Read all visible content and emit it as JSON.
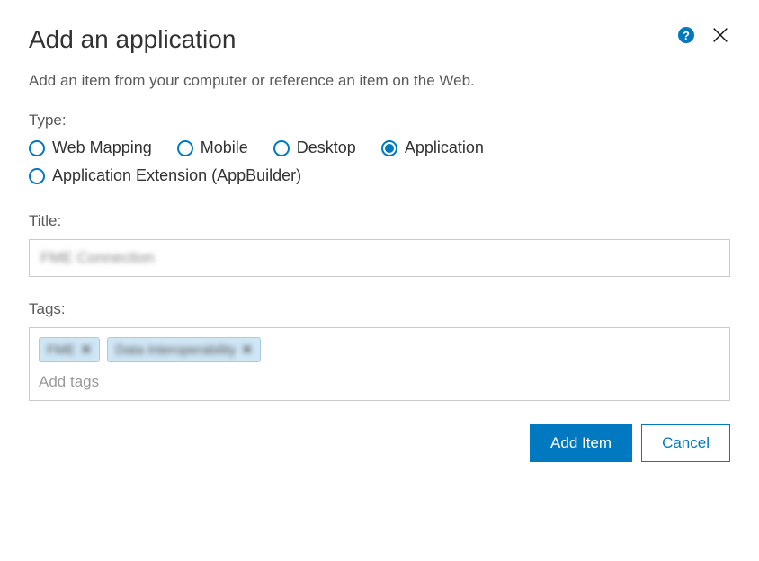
{
  "dialog": {
    "title": "Add an application",
    "subtitle": "Add an item from your computer or reference an item on the Web."
  },
  "type_field": {
    "label": "Type:",
    "options": [
      {
        "id": "web-mapping",
        "label": "Web Mapping",
        "selected": false
      },
      {
        "id": "mobile",
        "label": "Mobile",
        "selected": false
      },
      {
        "id": "desktop",
        "label": "Desktop",
        "selected": false
      },
      {
        "id": "application",
        "label": "Application",
        "selected": true
      },
      {
        "id": "app-extension",
        "label": "Application Extension (AppBuilder)",
        "selected": false
      }
    ]
  },
  "title_field": {
    "label": "Title:",
    "value": "FME Connection"
  },
  "tags_field": {
    "label": "Tags:",
    "tags": [
      {
        "label": "FME"
      },
      {
        "label": "Data Interoperability"
      }
    ],
    "placeholder": "Add tags",
    "remove_glyph": "✕"
  },
  "buttons": {
    "primary": "Add Item",
    "secondary": "Cancel"
  },
  "icons": {
    "help_glyph": "?"
  }
}
